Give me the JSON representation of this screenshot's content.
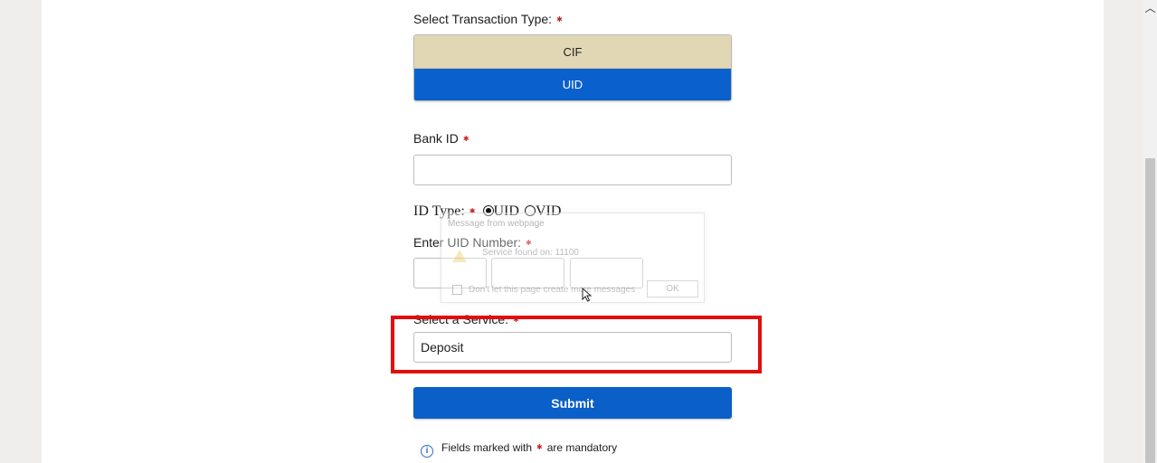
{
  "transaction_type": {
    "label": "Select Transaction Type:",
    "options": [
      "CIF",
      "UID"
    ],
    "selected": "UID"
  },
  "bank_id": {
    "label": "Bank ID",
    "value": ""
  },
  "id_type": {
    "label": "ID Type:",
    "options": [
      "UID",
      "VID"
    ],
    "selected": "UID"
  },
  "uid_number": {
    "label": "Enter UID Number:",
    "parts": [
      "",
      "",
      ""
    ]
  },
  "service": {
    "label": "Select a Service:",
    "value": "Deposit"
  },
  "submit_label": "Submit",
  "footer_note": {
    "prefix": "Fields marked with",
    "suffix": "are mandatory"
  },
  "dialog_overlay": {
    "title": "Message from webpage",
    "message": "Service found on: 11100",
    "checkbox_label": "Don't let this page create more messages",
    "ok_label": "OK"
  },
  "colors": {
    "primary_button": "#0a5fc8",
    "selected_option": "#0a60cc",
    "unselected_option": "#e1d7b4",
    "required_mark": "#c81e1e",
    "highlight_box": "#e30d0d"
  },
  "icons": {
    "info": "info-circle-icon",
    "required": "asterisk-icon"
  }
}
